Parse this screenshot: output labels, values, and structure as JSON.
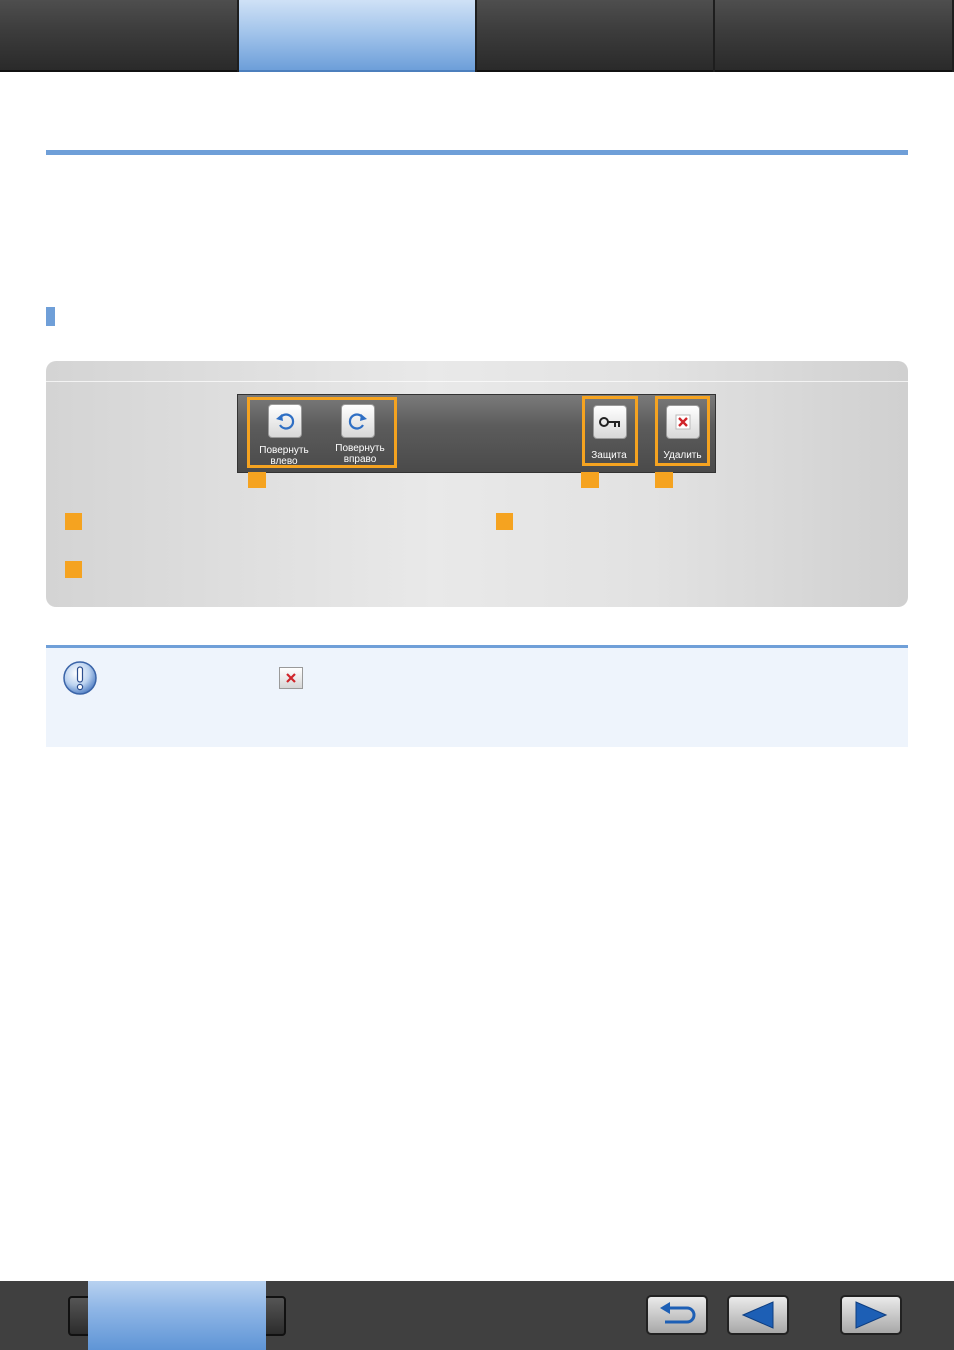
{
  "toolbar": {
    "rotate_left_label": "Повернуть влево",
    "rotate_right_label": "Повернуть вправо",
    "protect_label": "Защита",
    "delete_label": "Удалить"
  },
  "colors": {
    "accent_blue": "#6f9fd8",
    "highlight_orange": "#f5a320",
    "delete_red": "#d0252a"
  },
  "icons": {
    "rotate_left": "rotate-ccw-icon",
    "rotate_right": "rotate-cw-icon",
    "protect": "key-icon",
    "delete": "close-icon",
    "note": "exclamation-icon",
    "back": "return-arrow-icon",
    "previous": "triangle-left-icon",
    "next": "triangle-right-icon"
  }
}
